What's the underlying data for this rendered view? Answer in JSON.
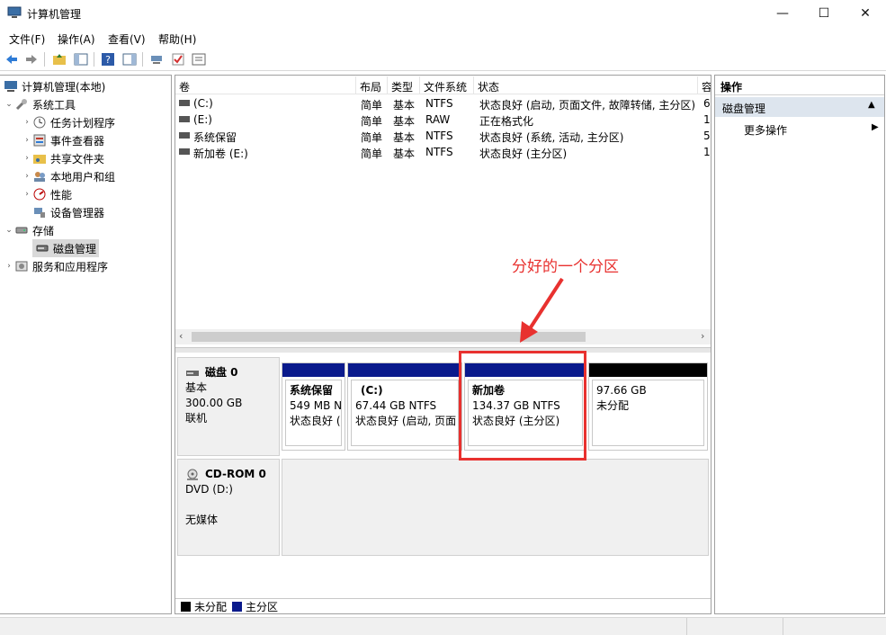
{
  "window": {
    "title": "计算机管理",
    "controls": {
      "minimize": "—",
      "maximize": "☐",
      "close": "✕"
    }
  },
  "menu": [
    "文件(F)",
    "操作(A)",
    "查看(V)",
    "帮助(H)"
  ],
  "tree": {
    "root": "计算机管理(本地)",
    "system_tools": "系统工具",
    "task_scheduler": "任务计划程序",
    "event_viewer": "事件查看器",
    "shared_folders": "共享文件夹",
    "local_users": "本地用户和组",
    "performance": "性能",
    "device_manager": "设备管理器",
    "storage": "存储",
    "disk_management": "磁盘管理",
    "services_apps": "服务和应用程序"
  },
  "volumes": {
    "headers": {
      "volume": "卷",
      "layout": "布局",
      "type": "类型",
      "fs": "文件系统",
      "status": "状态",
      "extra": "容"
    },
    "rows": [
      {
        "name": "(C:)",
        "layout": "简单",
        "type": "基本",
        "fs": "NTFS",
        "status": "状态良好 (启动, 页面文件, 故障转储, 主分区)",
        "extra": "6"
      },
      {
        "name": "(E:)",
        "layout": "简单",
        "type": "基本",
        "fs": "RAW",
        "status": "正在格式化",
        "extra": "1"
      },
      {
        "name": "系统保留",
        "layout": "简单",
        "type": "基本",
        "fs": "NTFS",
        "status": "状态良好 (系统, 活动, 主分区)",
        "extra": "5"
      },
      {
        "name": "新加卷 (E:)",
        "layout": "简单",
        "type": "基本",
        "fs": "NTFS",
        "status": "状态良好 (主分区)",
        "extra": "1"
      }
    ]
  },
  "disk0": {
    "name": "磁盘 0",
    "type": "基本",
    "size": "300.00 GB",
    "state": "联机",
    "partitions": [
      {
        "name": "系统保留",
        "size": "549 MB N",
        "status": "状态良好 (",
        "bar": "#0a1a8c"
      },
      {
        "name": "(C:)",
        "size": "67.44 GB NTFS",
        "status": "状态良好 (启动, 页面",
        "bar": "#0a1a8c"
      },
      {
        "name": "新加卷",
        "size": "134.37 GB NTFS",
        "status": "状态良好 (主分区)",
        "bar": "#0a1a8c"
      },
      {
        "name": "",
        "size": "97.66 GB",
        "status": "未分配",
        "bar": "#000000"
      }
    ]
  },
  "cdrom0": {
    "name": "CD-ROM 0",
    "type": "DVD (D:)",
    "state": "无媒体"
  },
  "legend": {
    "unallocated": "未分配",
    "primary": "主分区",
    "unallocated_color": "#000000",
    "primary_color": "#0a1a8c"
  },
  "actions": {
    "header": "操作",
    "section": "磁盘管理",
    "more": "更多操作"
  },
  "annotation": {
    "text": "分好的一个分区",
    "color": "#e8312f"
  }
}
